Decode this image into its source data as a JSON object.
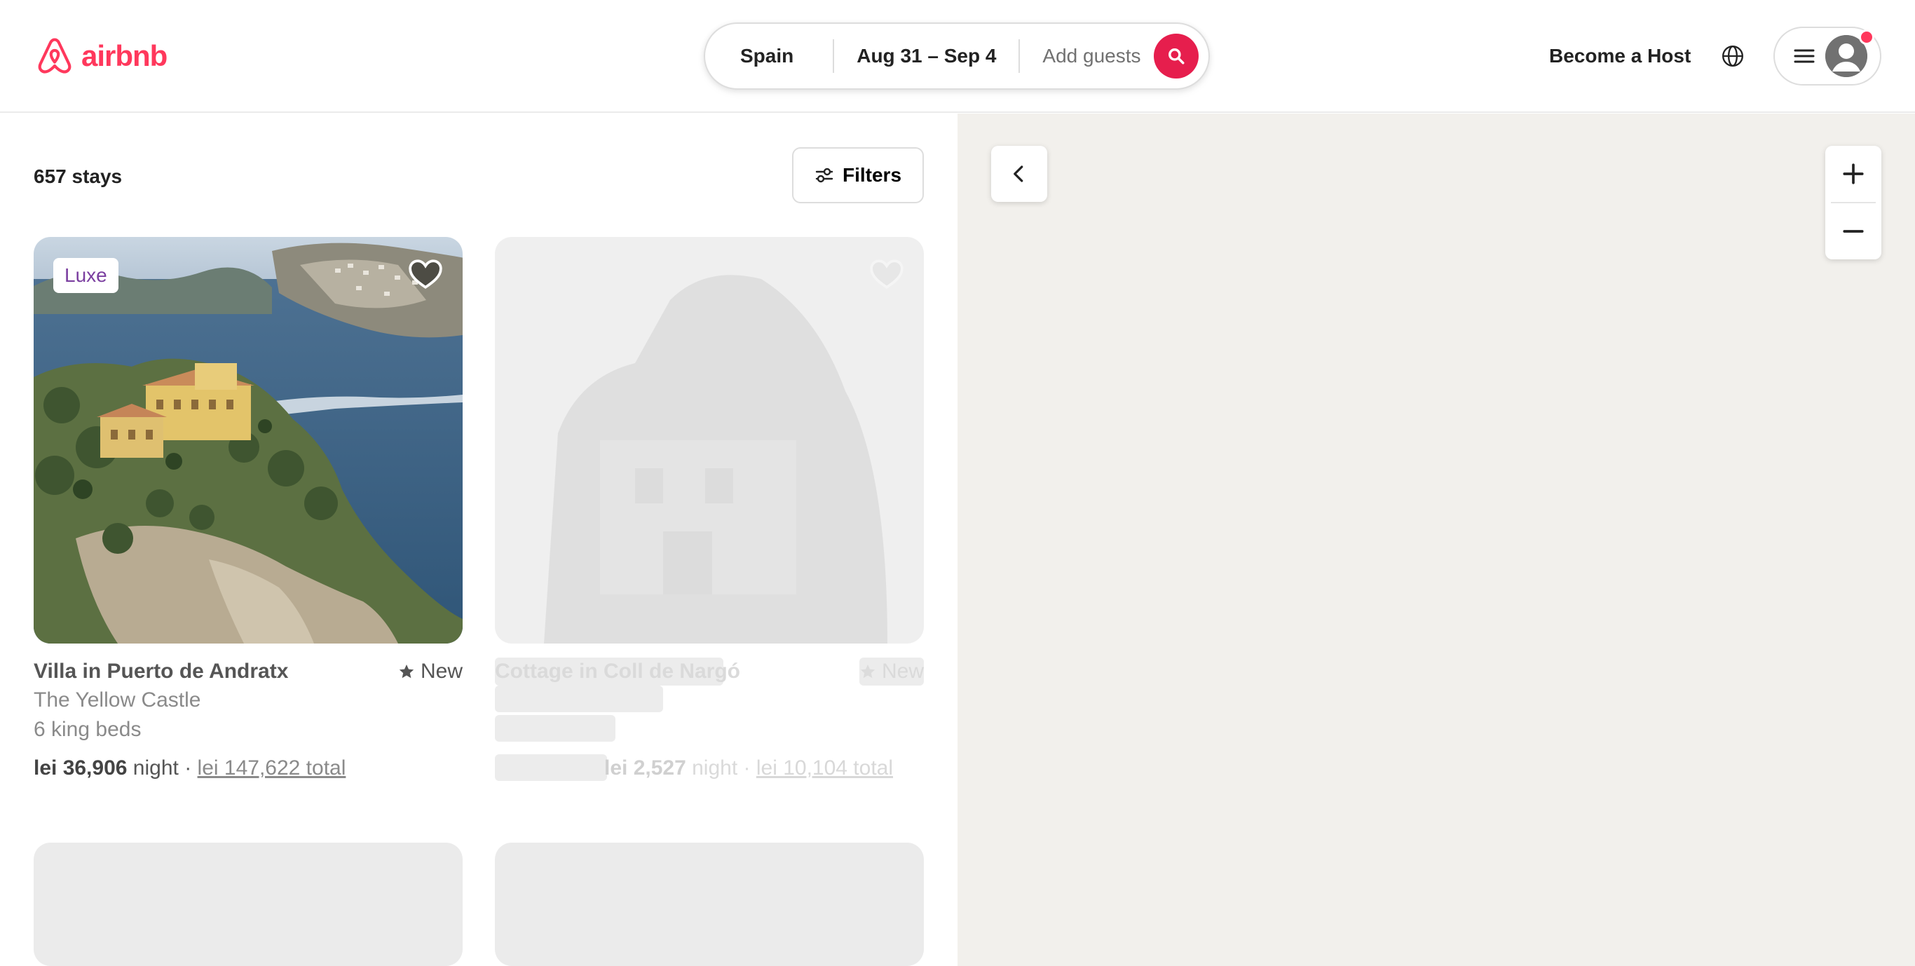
{
  "brand": {
    "name": "airbnb",
    "color": "#ff385c",
    "icon": "airbnb-belo-logo"
  },
  "search": {
    "location": "Spain",
    "dates": "Aug 31 – Sep 4",
    "guests_placeholder": "Add guests",
    "button_icon": "search-icon",
    "button_color": "#e61e4d"
  },
  "header": {
    "host_link": "Become a Host",
    "language_icon": "globe-icon",
    "menu_icon": "hamburger-icon",
    "avatar_icon": "user-avatar-icon",
    "notification_color": "#ff385c"
  },
  "results": {
    "count_label": "657 stays",
    "filters_label": "Filters",
    "filters_icon": "sliders-icon"
  },
  "listings": [
    {
      "badge": "Luxe",
      "title": "Villa in Puerto de Andratx",
      "rating": "New",
      "subtitle": "The Yellow Castle",
      "beds": "6 king beds",
      "price": "lei 36,906",
      "price_unit": "night",
      "separator": "·",
      "total": "lei 147,622 total"
    },
    {
      "title": "Cottage in Coll de Nargó",
      "rating": "New",
      "price": "lei 2,527",
      "price_unit": "night",
      "separator": "·",
      "total": "lei 10,104 total"
    }
  ],
  "map": {
    "background": "#f2f0ec",
    "collapse_icon": "chevron-left-icon",
    "zoom_in_icon": "plus-icon",
    "zoom_out_icon": "minus-icon"
  }
}
